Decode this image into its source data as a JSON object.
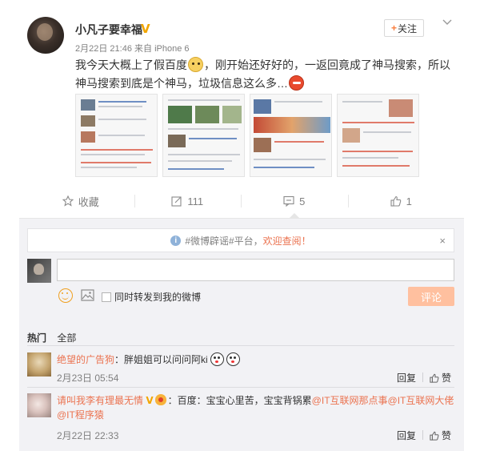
{
  "post": {
    "username": "小凡子要幸福",
    "verified_badge": "V",
    "date": "2月22日 21:46",
    "source_prefix": "来自",
    "source": "iPhone 6",
    "follow_label": "关注",
    "follow_plus": "+",
    "text_part1": "我今天大概上了假百度",
    "text_part2": "，刚开始还好好的，一返回竟成了神马搜索，所以神马搜索到底是个神马，垃圾信息这么多…",
    "emoji_1": "doge-emoji",
    "emoji_2": "angry-emoji",
    "screenshot_count": 4
  },
  "actions": {
    "favorite_label": "收藏",
    "forward_count": "111",
    "comment_count": "5",
    "like_count": "1"
  },
  "comment_area": {
    "notice_prefix": "#微博辟谣#平台，",
    "notice_highlight": "欢迎查阅！",
    "notice_close": "×",
    "input_placeholder": "",
    "forward_label": "同时转发到我的微博",
    "submit_label": "评论",
    "tabs": [
      "热门",
      "全部"
    ]
  },
  "comments": [
    {
      "nickname": "绝望的广告狗",
      "text": "：胖姐姐可以问问阿ki",
      "time": "2月23日 05:54",
      "reply_label": "回复",
      "like_label": "赞"
    },
    {
      "nickname": "请叫我李有理最无情",
      "verified_badge": "V",
      "text": "：百度：宝宝心里苦，宝宝背锅累",
      "mention_1": "@IT互联网那点事",
      "mention_2": "@IT互联网大佬",
      "mention_3": "@IT程序猿",
      "time": "2月22日 22:33",
      "reply_label": "回复",
      "like_label": "赞"
    }
  ],
  "colors": {
    "accent_orange": "#eb7350",
    "verified_gold": "#f2a600",
    "submit_disabled": "#ffc09f",
    "panel_bg": "#f2f2f5"
  }
}
